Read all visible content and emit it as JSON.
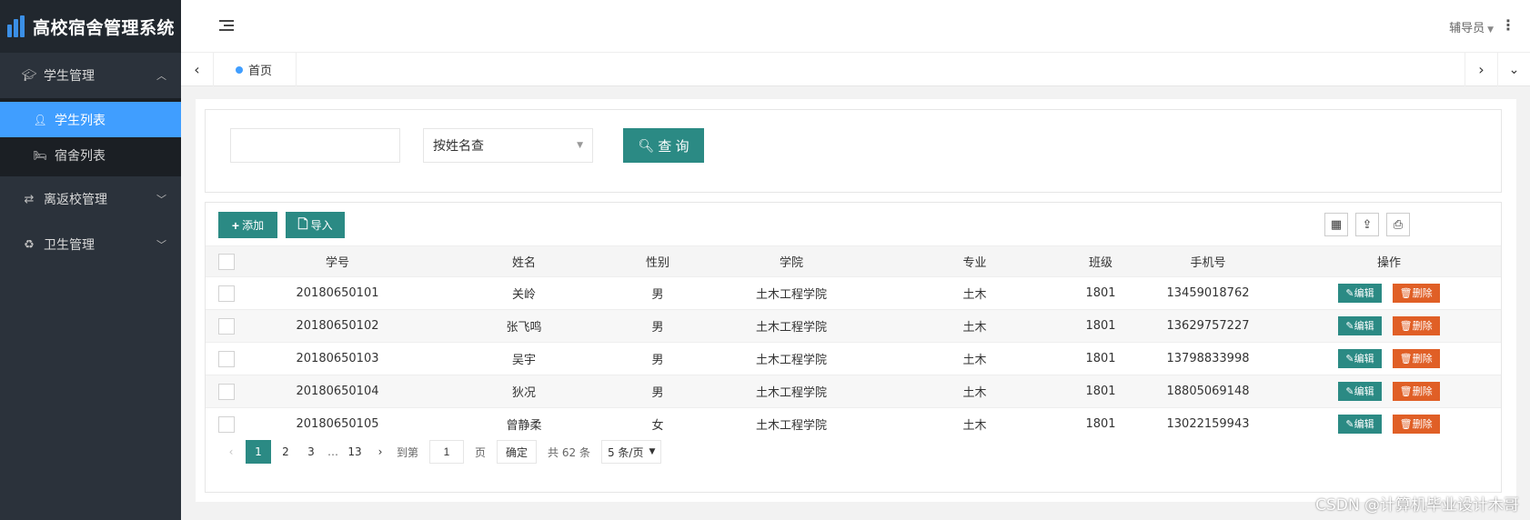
{
  "app": {
    "title": "高校宿舍管理系统"
  },
  "sidebar": {
    "groups": [
      {
        "label": "学生管理",
        "icon": "graduation-cap-icon",
        "expanded": true,
        "items": [
          {
            "label": "学生列表",
            "icon": "user-icon",
            "active": true
          },
          {
            "label": "宿舍列表",
            "icon": "bed-icon",
            "active": false
          }
        ]
      },
      {
        "label": "离返校管理",
        "icon": "exchange-icon",
        "expanded": false
      },
      {
        "label": "卫生管理",
        "icon": "recycle-icon",
        "expanded": false
      }
    ]
  },
  "header": {
    "user_label": "辅导员"
  },
  "tabs": {
    "home_label": "首页"
  },
  "search": {
    "input_value": "",
    "select_value": "按姓名查",
    "button_label": "查 询"
  },
  "toolbar": {
    "add_label": "添加",
    "import_label": "导入"
  },
  "table": {
    "columns": [
      "学号",
      "姓名",
      "性别",
      "学院",
      "专业",
      "班级",
      "手机号",
      "操作"
    ],
    "edit_label": "编辑",
    "delete_label": "删除",
    "rows": [
      [
        "20180650101",
        "关岭",
        "男",
        "土木工程学院",
        "土木",
        "1801",
        "13459018762"
      ],
      [
        "20180650102",
        "张飞鸣",
        "男",
        "土木工程学院",
        "土木",
        "1801",
        "13629757227"
      ],
      [
        "20180650103",
        "吴宇",
        "男",
        "土木工程学院",
        "土木",
        "1801",
        "13798833998"
      ],
      [
        "20180650104",
        "狄况",
        "男",
        "土木工程学院",
        "土木",
        "1801",
        "18805069148"
      ],
      [
        "20180650105",
        "曾静柔",
        "女",
        "土木工程学院",
        "土木",
        "1801",
        "13022159943"
      ]
    ]
  },
  "pagination": {
    "pages": [
      "1",
      "2",
      "3"
    ],
    "ellipsis": "…",
    "last_page": "13",
    "goto_prefix": "到第",
    "goto_value": "1",
    "goto_suffix": "页",
    "confirm_label": "确定",
    "total_text": "共 62 条",
    "page_size": "5 条/页"
  },
  "watermark": "CSDN @计算机毕业设计木哥",
  "colors": {
    "sidebar_bg": "#2b323b",
    "active_item": "#409eff",
    "primary_btn": "#2b8a84",
    "danger_btn": "#e05f26"
  }
}
